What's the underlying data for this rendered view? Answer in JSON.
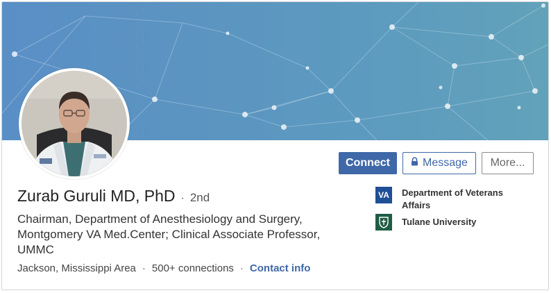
{
  "profile": {
    "name": "Zurab Guruli MD, PhD",
    "degree_separator": "·",
    "degree": "2nd",
    "headline": "Chairman, Department of Anesthesiology and Surgery, Montgomery VA Med.Center; Clinical Associate Professor, UMMC",
    "location": "Jackson, Mississippi Area",
    "connections": "500+ connections",
    "contact_info": "Contact info",
    "meta_separator": "·"
  },
  "actions": {
    "connect": "Connect",
    "message": "Message",
    "more": "More..."
  },
  "organizations": [
    {
      "name": "Department of Veterans Affairs",
      "logo_text": "VA",
      "logo_color": "#1f4f95"
    },
    {
      "name": "Tulane University",
      "logo_icon": "tulane-shield-icon",
      "logo_color": "#1f5d45"
    }
  ],
  "colors": {
    "accent": "#3f68a8",
    "banner": "#5b95c0"
  }
}
